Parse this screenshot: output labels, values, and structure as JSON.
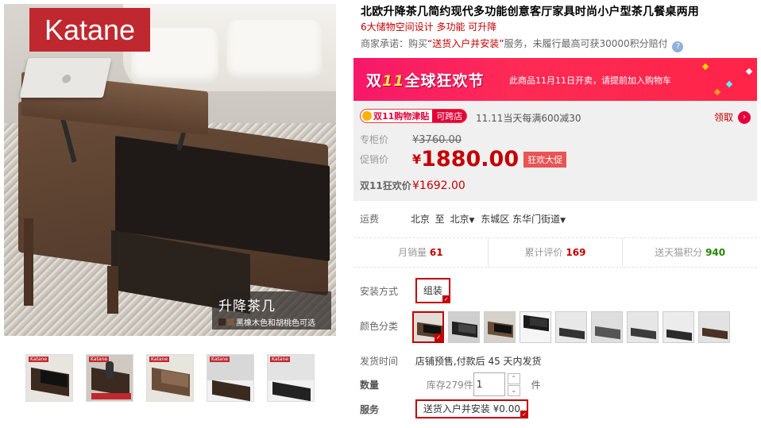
{
  "gallery": {
    "brand": "Katane",
    "caption_title": "升降茶几",
    "caption_sub": "黑橡木色和胡桃色可选",
    "thumbs": [
      {
        "brand": "Katane"
      },
      {
        "brand": "Katane"
      },
      {
        "brand": "Katane"
      },
      {
        "brand": "Katane"
      },
      {
        "brand": "Katane"
      }
    ]
  },
  "product": {
    "title": "北欧升降茶几简约现代多功能创意客厅家具时尚小户型茶几餐桌两用",
    "subtitle": "6大储物空间设计  多功能  可升降",
    "promise_prefix": "商家承诺：购买",
    "promise_highlight": "“送货入户并安装”",
    "promise_suffix": "服务，未履行最高可获30000积分赔付",
    "promise_icon": "?"
  },
  "promo": {
    "banner_logo_a": "双",
    "banner_logo_11": "11",
    "banner_logo_b": "全球狂欢节",
    "banner_text": "此商品11月11日开卖，请提前加入购物车",
    "coupon_tag_a": "双11购物津贴",
    "coupon_tag_b": "可跨店",
    "coupon_text": "11.11当天每满600减30",
    "claim_label": "领取",
    "claim_arrow": "›",
    "list_price_label": "专柜价",
    "list_price": "¥3760.00",
    "promo_price_label": "促销价",
    "yen": "¥",
    "promo_price": "1880.00",
    "deal_badge": "狂欢大促",
    "d11_label": "双11狂欢价",
    "d11_price": "¥1692.00"
  },
  "shipping": {
    "label": "运费",
    "from": "北京",
    "to_word": "至",
    "city": "北京",
    "district": "东城区",
    "street": "东华门街道"
  },
  "stats": {
    "monthly_sales_label": "月销量",
    "monthly_sales": "61",
    "reviews_label": "累计评价",
    "reviews": "169",
    "points_label": "送天猫积分",
    "points": "940"
  },
  "options": {
    "install_label": "安装方式",
    "install_value": "组装",
    "color_label": "颜色分类",
    "colors_count": 9,
    "delivery_label": "发货时间",
    "delivery_value": "店铺预售,付款后 45 天内发货",
    "qty_label": "数量",
    "stock_text": "库存279件",
    "qty_value": "1",
    "qty_unit": "件",
    "service_label": "服务",
    "service_value": "送货入户并安装 ¥0.00"
  },
  "colors": {
    "accent": "#c40000",
    "banner": "#ff2448",
    "points_green": "#228800"
  }
}
